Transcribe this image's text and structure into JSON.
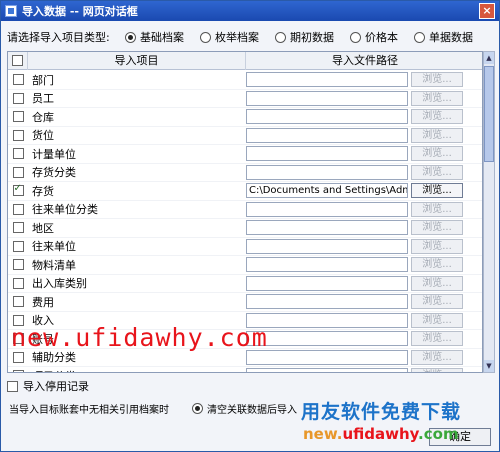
{
  "window": {
    "title": "导入数据 -- 网页对话框",
    "close_glyph": "×"
  },
  "type_selector": {
    "prompt": "请选择导入项目类型:",
    "options": [
      {
        "label": "基础档案",
        "selected": true
      },
      {
        "label": "枚举档案",
        "selected": false
      },
      {
        "label": "期初数据",
        "selected": false
      },
      {
        "label": "价格本",
        "selected": false
      },
      {
        "label": "单据数据",
        "selected": false
      }
    ]
  },
  "table": {
    "header": {
      "item": "导入项目",
      "path": "导入文件路径"
    },
    "browse_label": "浏览...",
    "rows": [
      {
        "name": "部门",
        "checked": false,
        "path": "",
        "browse_enabled": false
      },
      {
        "name": "员工",
        "checked": false,
        "path": "",
        "browse_enabled": false
      },
      {
        "name": "仓库",
        "checked": false,
        "path": "",
        "browse_enabled": false
      },
      {
        "name": "货位",
        "checked": false,
        "path": "",
        "browse_enabled": false
      },
      {
        "name": "计量单位",
        "checked": false,
        "path": "",
        "browse_enabled": false
      },
      {
        "name": "存货分类",
        "checked": false,
        "path": "",
        "browse_enabled": false
      },
      {
        "name": "存货",
        "checked": true,
        "path": "C:\\Documents and Settings\\Admi...",
        "browse_enabled": true
      },
      {
        "name": "往来单位分类",
        "checked": false,
        "path": "",
        "browse_enabled": false
      },
      {
        "name": "地区",
        "checked": false,
        "path": "",
        "browse_enabled": false
      },
      {
        "name": "往来单位",
        "checked": false,
        "path": "",
        "browse_enabled": false
      },
      {
        "name": "物料清单",
        "checked": false,
        "path": "",
        "browse_enabled": false
      },
      {
        "name": "出入库类别",
        "checked": false,
        "path": "",
        "browse_enabled": false
      },
      {
        "name": "费用",
        "checked": false,
        "path": "",
        "browse_enabled": false
      },
      {
        "name": "收入",
        "checked": false,
        "path": "",
        "browse_enabled": false
      },
      {
        "name": "账号",
        "checked": false,
        "path": "",
        "browse_enabled": false
      },
      {
        "name": "辅助分类",
        "checked": false,
        "path": "",
        "browse_enabled": false
      },
      {
        "name": "项目分类",
        "checked": false,
        "path": "",
        "browse_enabled": false
      }
    ]
  },
  "scrollbar": {
    "up_glyph": "▲",
    "down_glyph": "▼"
  },
  "import_disabled": {
    "label": "导入停用记录",
    "checked": false
  },
  "bottom": {
    "label": "当导入目标账套中无相关引用档案时",
    "option_label": "清空关联数据后导入",
    "option_selected": true
  },
  "ok_button": {
    "label": "确定"
  },
  "watermarks": {
    "big_url": "new.ufidawhy.com",
    "cn_text": "用友软件免费下载",
    "url_parts": [
      "new.",
      "ufidawhy",
      ".com"
    ]
  }
}
